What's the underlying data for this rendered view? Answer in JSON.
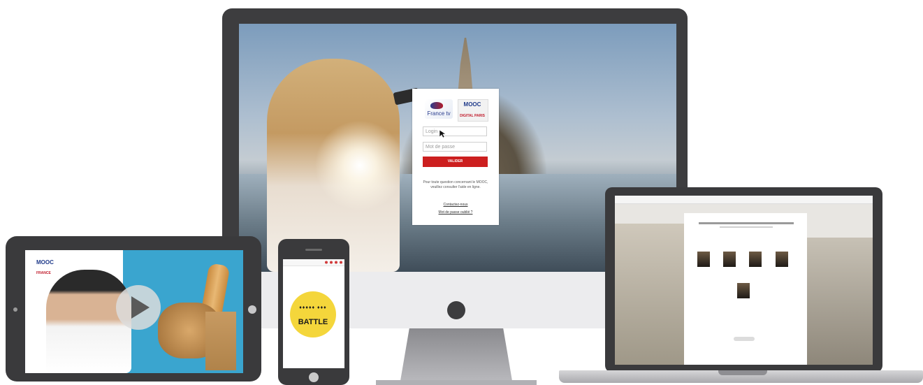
{
  "desktop": {
    "login_form": {
      "logo_france": "France tv",
      "logo_mooc": "MOOC",
      "logo_mooc_sub": "DIGITAL PARIS",
      "login_placeholder": "Login",
      "password_placeholder": "Mot de passe",
      "submit_label": "VALIDER",
      "info_text": "Pour toute question concernant le MOOC, veuillez consulter l'aide en ligne.",
      "link_help": "Contactez-nous",
      "link_forgot": "Mot de passe oublié ?"
    }
  },
  "tablet": {
    "logo": "MOOC",
    "logo_sub": "FRANCE"
  },
  "phone": {
    "battle_label": "BATTLE"
  },
  "colors": {
    "accent_red": "#cc1f1f",
    "battle_yellow": "#f4d63b",
    "tablet_blue": "#3aa5cf",
    "device_frame": "#3a3a3c"
  }
}
